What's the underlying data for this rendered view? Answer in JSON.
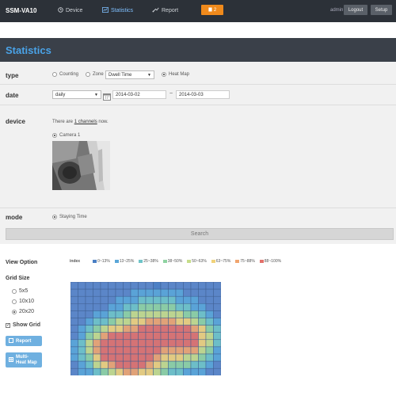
{
  "header": {
    "brand": "SSM-VA10",
    "nav": [
      {
        "label": "Device",
        "icon": "clock-icon"
      },
      {
        "label": "Statistics",
        "icon": "chart-icon"
      },
      {
        "label": "Report",
        "icon": "report-icon"
      }
    ],
    "badge": "2",
    "user": "admin",
    "logout": "Logout",
    "setup": "Setup"
  },
  "page": {
    "title": "Statistics"
  },
  "form": {
    "type": {
      "label": "type",
      "counting": "Counting",
      "zone": "Zone",
      "zone_select": "Dwell Time",
      "heatmap": "Heat Map"
    },
    "date": {
      "label": "date",
      "period": "daily",
      "from": "2014-03-02",
      "sep": "~",
      "to": "2014-03-03"
    },
    "device": {
      "label": "device",
      "note_prefix": "There are ",
      "channels": "1 channels",
      "note_suffix": " now.",
      "camera": "Camera 1"
    },
    "mode": {
      "label": "mode",
      "staying": "Staying Time"
    },
    "search": "Search"
  },
  "view": {
    "title": "View Option",
    "grid_size": "Grid Size",
    "sizes": [
      "5x5",
      "10x10",
      "20x20"
    ],
    "selected_size": "20x20",
    "show_grid": "Show Grid",
    "report": "Report",
    "multi_heat_map": "Multi-\nHeat Map"
  },
  "legend": {
    "label": "index",
    "items": [
      {
        "text": "0~13%",
        "color": "#4a7fc4"
      },
      {
        "text": "13~25%",
        "color": "#5aa6d8"
      },
      {
        "text": "25~38%",
        "color": "#6fc4c8"
      },
      {
        "text": "38~50%",
        "color": "#8fd3a2"
      },
      {
        "text": "50~63%",
        "color": "#c6dd8a"
      },
      {
        "text": "63~75%",
        "color": "#f1d27a"
      },
      {
        "text": "75~88%",
        "color": "#f0a56f"
      },
      {
        "text": "88~100%",
        "color": "#e2716b"
      }
    ]
  },
  "heatmap": {
    "cols": 20,
    "rows": 13,
    "base_color": "#5b86c8"
  }
}
